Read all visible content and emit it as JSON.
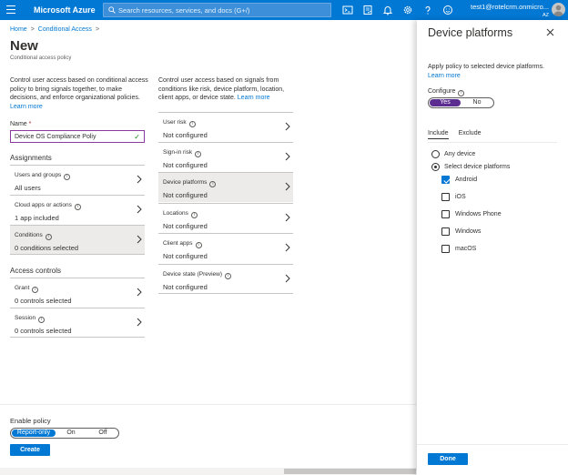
{
  "topbar": {
    "brand": "Microsoft Azure",
    "search_placeholder": "Search resources, services, and docs (G+/)",
    "account_email": "test1@rotelcrm.onmicro...",
    "account_tenant": "AZ",
    "icons": [
      "menu-icon",
      "search-icon",
      "cloud-shell-icon",
      "directory-filter-icon",
      "notifications-icon",
      "settings-icon",
      "help-icon",
      "feedback-icon",
      "avatar"
    ]
  },
  "breadcrumb": {
    "home": "Home",
    "sep": ">",
    "conditional_access": "Conditional Access"
  },
  "page": {
    "title": "New",
    "subtitle": "Conditional access policy"
  },
  "left_desc": "Control user access based on conditional access policy to bring signals together, to make decisions, and enforce organizational policies.",
  "left_learn_more": "Learn more",
  "right_desc": "Control user access based on signals from conditions like risk, device platform, location, client apps, or device state.",
  "right_learn_more": "Learn more",
  "name_field": {
    "label": "Name",
    "required": "*",
    "value": "Device OS Compliance Poliy",
    "check": "✓"
  },
  "assignments": {
    "heading": "Assignments",
    "users": {
      "label": "Users and groups",
      "value": "All users"
    },
    "apps": {
      "label": "Cloud apps or actions",
      "value": "1 app included"
    },
    "conditions": {
      "label": "Conditions",
      "value": "0 conditions selected"
    }
  },
  "access_controls": {
    "heading": "Access controls",
    "grant": {
      "label": "Grant",
      "value": "0 controls selected"
    },
    "session": {
      "label": "Session",
      "value": "0 controls selected"
    }
  },
  "conditions_list": [
    {
      "label": "User risk",
      "value": "Not configured"
    },
    {
      "label": "Sign-in risk",
      "value": "Not configured"
    },
    {
      "label": "Device platforms",
      "value": "Not configured"
    },
    {
      "label": "Locations",
      "value": "Not configured"
    },
    {
      "label": "Client apps",
      "value": "Not configured"
    },
    {
      "label": "Device state (Preview)",
      "value": "Not configured"
    }
  ],
  "info_glyph": "i",
  "enable_policy": {
    "label": "Enable policy",
    "options": [
      "Report-only",
      "On",
      "Off"
    ],
    "selected": "Report-only"
  },
  "create_label": "Create",
  "panel": {
    "title": "Device platforms",
    "desc": "Apply policy to selected device platforms.",
    "learn_more": "Learn more",
    "configure_label": "Configure",
    "yes": "Yes",
    "no": "No",
    "configure_value": "Yes",
    "tabs": [
      "Include",
      "Exclude"
    ],
    "active_tab": "Include",
    "radio_any": "Any device",
    "radio_select": "Select device platforms",
    "selected_radio": "Select device platforms",
    "platforms": [
      {
        "label": "Android",
        "checked": true
      },
      {
        "label": "iOS",
        "checked": false
      },
      {
        "label": "Windows Phone",
        "checked": false
      },
      {
        "label": "Windows",
        "checked": false
      },
      {
        "label": "macOS",
        "checked": false
      }
    ],
    "done_label": "Done"
  },
  "colors": {
    "accent": "#0078d4",
    "toggle_yes": "#5c2d91",
    "topbar": "#0078d4",
    "selected_card": "#edebe9"
  }
}
